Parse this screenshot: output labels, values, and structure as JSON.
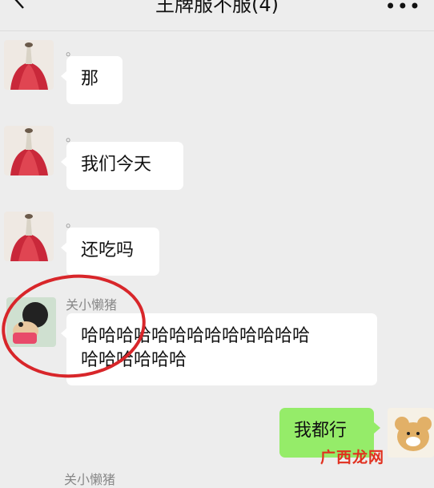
{
  "header": {
    "title": "王牌服不服(4)",
    "more": "•••"
  },
  "messages": [
    {
      "sender": "。",
      "text": "那"
    },
    {
      "sender": "。",
      "text": "我们今天"
    },
    {
      "sender": "。",
      "text": "还吃吗"
    },
    {
      "sender": "关小懒猪",
      "text_line1": "哈哈哈哈哈哈哈哈哈哈哈哈哈",
      "text_line2": "哈哈哈哈哈哈"
    },
    {
      "text": "我都行"
    }
  ],
  "partial_sender": "关小懒猪",
  "watermark": "广西龙网",
  "colors": {
    "highlight": "#d8262a",
    "my_bubble": "#95ec69",
    "watermark": "#e1301f"
  }
}
